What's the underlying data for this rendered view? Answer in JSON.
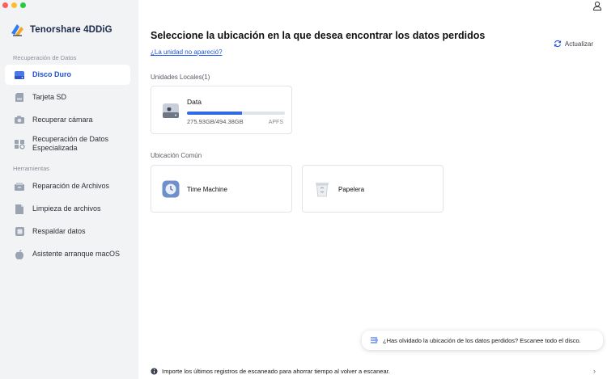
{
  "app": {
    "name": "Tenorshare 4DDiG"
  },
  "sidebar": {
    "section_recovery": "Recuperación de Datos",
    "section_tools": "Herramientas",
    "recovery_items": [
      {
        "label": "Disco Duro",
        "icon": "hard-drive-icon",
        "active": true
      },
      {
        "label": "Tarjeta SD",
        "icon": "sd-card-icon",
        "active": false
      },
      {
        "label": "Recuperar cámara",
        "icon": "camera-icon",
        "active": false
      },
      {
        "label": "Recuperación de Datos Especializada",
        "icon": "specialized-recovery-icon",
        "active": false
      }
    ],
    "tool_items": [
      {
        "label": "Reparación de Archivos",
        "icon": "file-repair-icon"
      },
      {
        "label": "Limpieza de archivos",
        "icon": "file-cleanup-icon"
      },
      {
        "label": "Respaldar datos",
        "icon": "backup-icon"
      },
      {
        "label": "Asistente arranque macOS",
        "icon": "apple-icon"
      }
    ]
  },
  "main": {
    "title": "Seleccione la ubicación en la que desea encontrar los datos perdidos",
    "missing_drive_link": "¿La unidad no apareció?",
    "refresh_label": "Actualizar",
    "local_drives_label": "Unidades Locales(1)",
    "drives": [
      {
        "name": "Data",
        "usage": "275.93GB/494.38GB",
        "filesystem": "APFS",
        "used_fraction": 0.558
      }
    ],
    "common_locations_label": "Ubicación Común",
    "locations": [
      {
        "label": "Time Machine",
        "icon": "time-machine-icon"
      },
      {
        "label": "Papelera",
        "icon": "trash-icon"
      }
    ]
  },
  "toast": {
    "text": "¿Has olvidado la ubicación de los datos perdidos? Escanee todo el disco."
  },
  "footer": {
    "text": "Importe los últimos registros de escaneado para ahorrar tiempo al volver a escanear."
  },
  "colors": {
    "accent": "#1f4fd8",
    "progress": "#2f6be6",
    "sidebar_bg": "#f2f3f5"
  }
}
